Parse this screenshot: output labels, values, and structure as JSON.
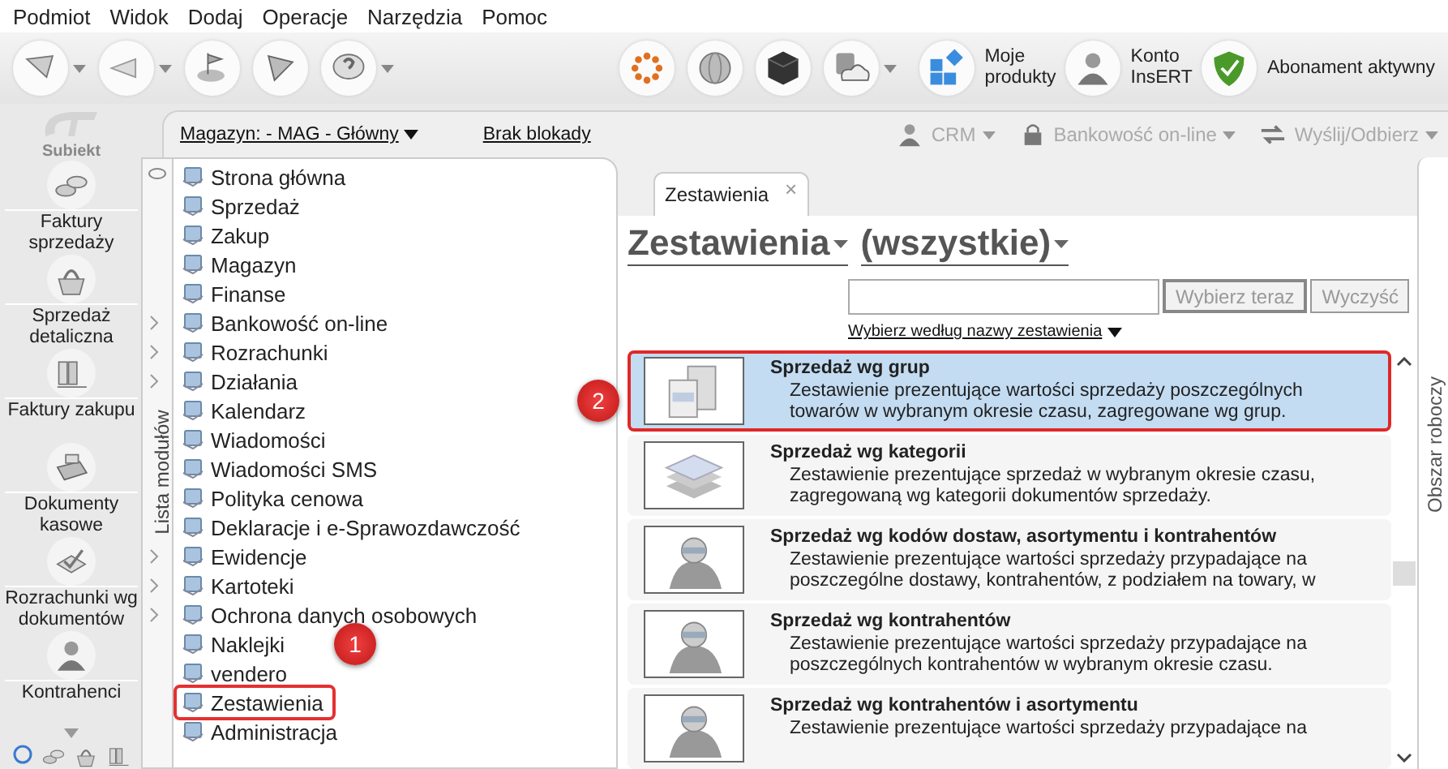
{
  "menu": [
    "Podmiot",
    "Widok",
    "Dodaj",
    "Operacje",
    "Narzędzia",
    "Pomoc"
  ],
  "toolbar": {
    "labeled": [
      {
        "label": "Moje\nprodukty"
      },
      {
        "label": "Konto\nInsERT"
      },
      {
        "label": "Abonament aktywny"
      }
    ]
  },
  "sidebar": {
    "logo": "Subiekt",
    "items": [
      {
        "label": "Faktury sprzedaży"
      },
      {
        "label": "Sprzedaż detaliczna"
      },
      {
        "label": "Faktury zakupu"
      },
      {
        "label": "Dokumenty kasowe"
      },
      {
        "label": "Rozrachunki wg dokumentów"
      },
      {
        "label": "Kontrahenci"
      }
    ]
  },
  "infobar": {
    "warehouse": "Magazyn: - MAG - Główny",
    "lock": "Brak blokady",
    "actions": [
      {
        "label": "CRM",
        "disabled": true
      },
      {
        "label": "Bankowość on-line",
        "disabled": true
      },
      {
        "label": "Wyślij/Odbierz",
        "disabled": true
      }
    ]
  },
  "modules": {
    "title": "Lista modułów",
    "items": [
      {
        "label": "Strona główna",
        "submenu": false,
        "selected": false
      },
      {
        "label": "Sprzedaż",
        "submenu": false,
        "selected": false
      },
      {
        "label": "Zakup",
        "submenu": false,
        "selected": false
      },
      {
        "label": "Magazyn",
        "submenu": false,
        "selected": false
      },
      {
        "label": "Finanse",
        "submenu": false,
        "selected": false
      },
      {
        "label": "Bankowość on-line",
        "submenu": true,
        "selected": false
      },
      {
        "label": "Rozrachunki",
        "submenu": true,
        "selected": false
      },
      {
        "label": "Działania",
        "submenu": true,
        "selected": false
      },
      {
        "label": "Kalendarz",
        "submenu": false,
        "selected": false
      },
      {
        "label": "Wiadomości",
        "submenu": false,
        "selected": false
      },
      {
        "label": "Wiadomości SMS",
        "submenu": false,
        "selected": false
      },
      {
        "label": "Polityka cenowa",
        "submenu": false,
        "selected": false
      },
      {
        "label": "Deklaracje i e-Sprawozdawczość",
        "submenu": false,
        "selected": false
      },
      {
        "label": "Ewidencje",
        "submenu": true,
        "selected": false
      },
      {
        "label": "Kartoteki",
        "submenu": true,
        "selected": false
      },
      {
        "label": "Ochrona danych osobowych",
        "submenu": true,
        "selected": false
      },
      {
        "label": "Naklejki",
        "submenu": false,
        "selected": false
      },
      {
        "label": "vendero",
        "submenu": false,
        "selected": false
      },
      {
        "label": "Zestawienia",
        "submenu": false,
        "selected": true
      },
      {
        "label": "Administracja",
        "submenu": false,
        "selected": false
      }
    ]
  },
  "callouts": [
    "1",
    "2"
  ],
  "tab": {
    "label": "Zestawienia",
    "close": "×"
  },
  "heading": {
    "type": "Zestawienia",
    "filter": "(wszystkie)"
  },
  "search": {
    "button": "Wybierz teraz",
    "clear": "Wyczyść",
    "mode": "Wybierz według nazwy zestawienia"
  },
  "reports": [
    {
      "kind": "boxes",
      "title": "Sprzedaż wg grup",
      "description": "Zestawienie prezentujące wartości sprzedaży poszczególnych\ntowarów w wybranym okresie czasu, zagregowane wg grup.",
      "selected": true
    },
    {
      "kind": "sheets",
      "title": "Sprzedaż wg kategorii",
      "description": "Zestawienie prezentujące sprzedaż w wybranym okresie czasu,\nzagregowaną wg kategorii dokumentów sprzedaży.",
      "selected": false
    },
    {
      "kind": "person",
      "title": "Sprzedaż wg kodów dostaw, asortymentu i kontrahentów",
      "description": "Zestawienie prezentujące wartości sprzedaży przypadające na\nposzczególne dostawy, kontrahentów, z podziałem na towary, w",
      "selected": false
    },
    {
      "kind": "person",
      "title": "Sprzedaż wg kontrahentów",
      "description": "Zestawienie prezentujące wartości sprzedaży przypadające na\nposzczególnych kontrahentów w wybranym okresie czasu.",
      "selected": false
    },
    {
      "kind": "person",
      "title": "Sprzedaż wg kontrahentów i asortymentu",
      "description": "Zestawienie prezentujące wartości sprzedaży przypadające na",
      "selected": false
    }
  ],
  "workspace": {
    "title": "Obszar roboczy"
  }
}
